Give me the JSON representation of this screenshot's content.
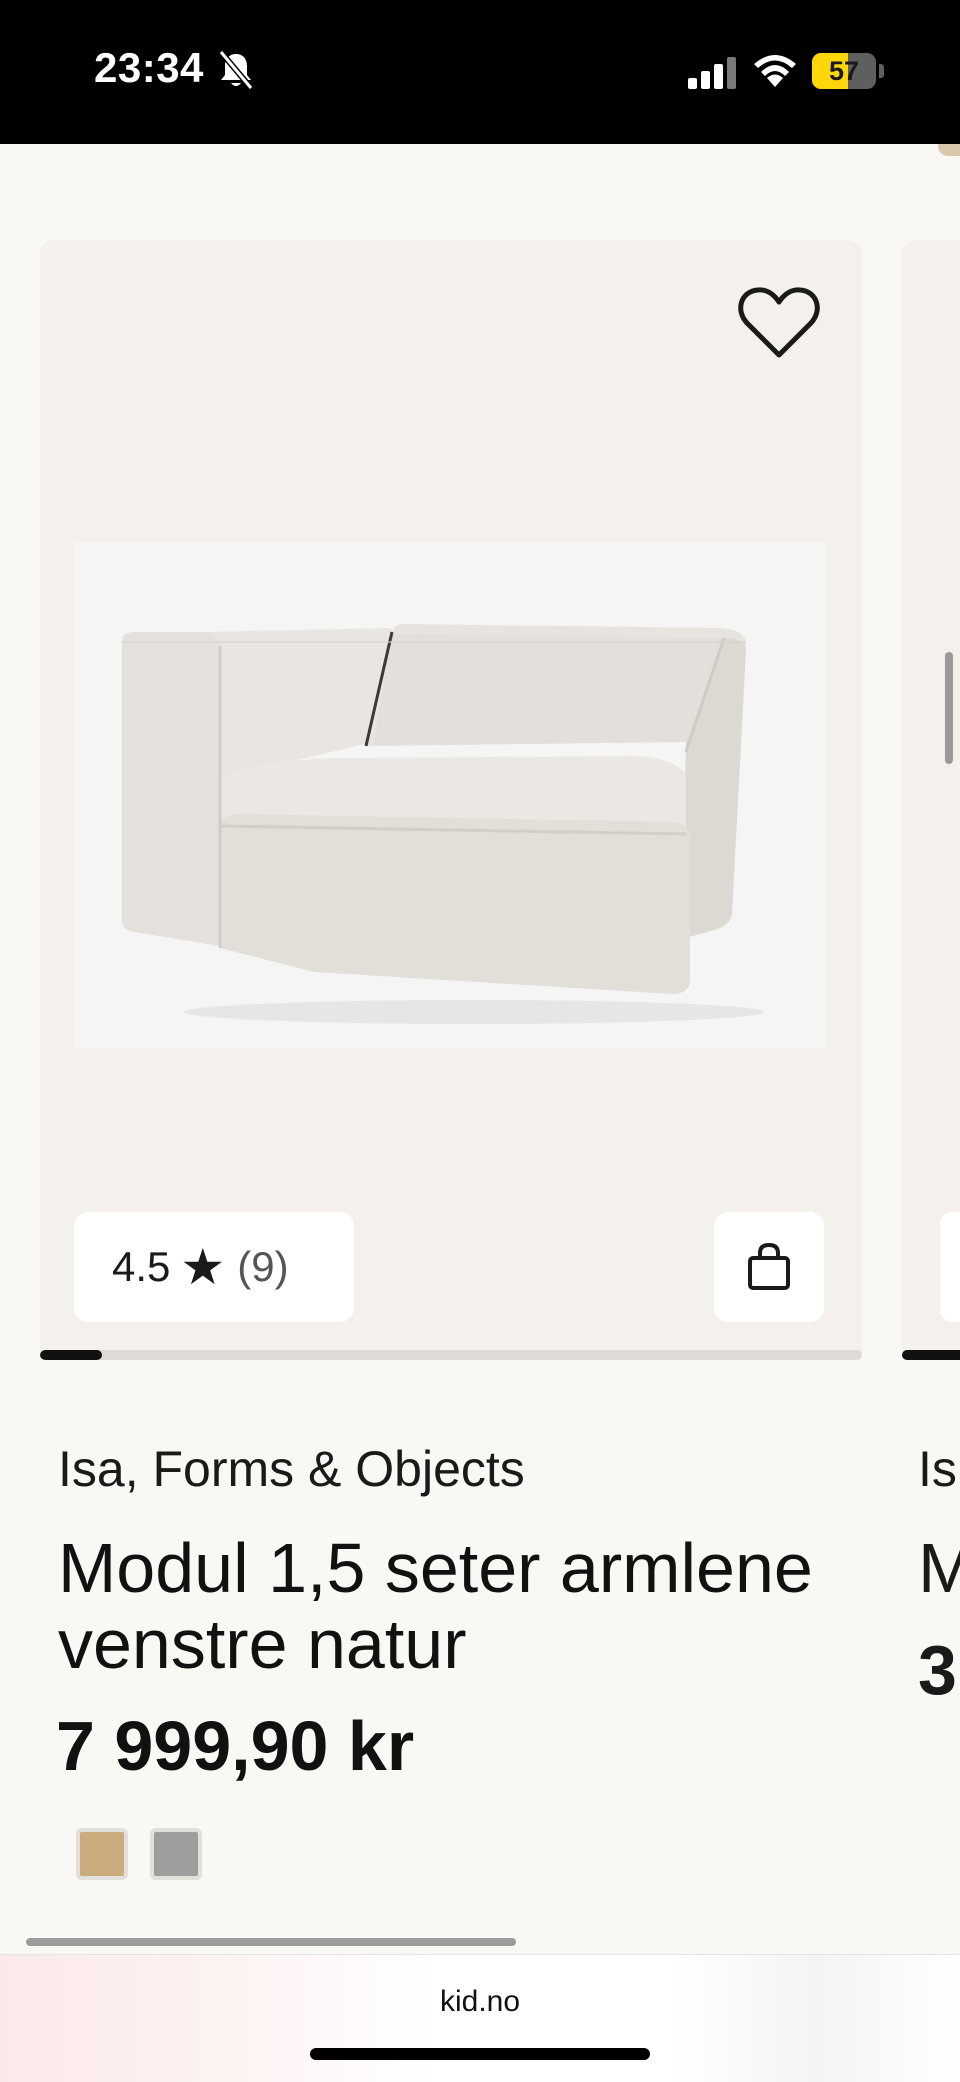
{
  "status_bar": {
    "time": "23:34",
    "battery_percent": "57",
    "battery_level": 0.57
  },
  "product": {
    "brand": "Isa, Forms & Objects",
    "name": "Modul 1,5 seter armlene venstre natur",
    "price": "7 999,90 kr",
    "rating": {
      "value": "4.5",
      "star": "★",
      "count": "(9)"
    },
    "image_progress": 0.075,
    "swatches": [
      {
        "name": "sand",
        "color": "#c9ab7e"
      },
      {
        "name": "grey",
        "color": "#9e9e9e"
      }
    ]
  },
  "next_product": {
    "brand": "Is",
    "name": "M",
    "price": "3"
  },
  "browser": {
    "url": "kid.no"
  },
  "colors": {
    "background": "#faf8f4",
    "card": "#f4f1ec",
    "text": "#111111"
  },
  "icons": {
    "favorite": "heart-outline-icon",
    "cart": "shopping-bag-icon",
    "rating": "star-icon"
  }
}
